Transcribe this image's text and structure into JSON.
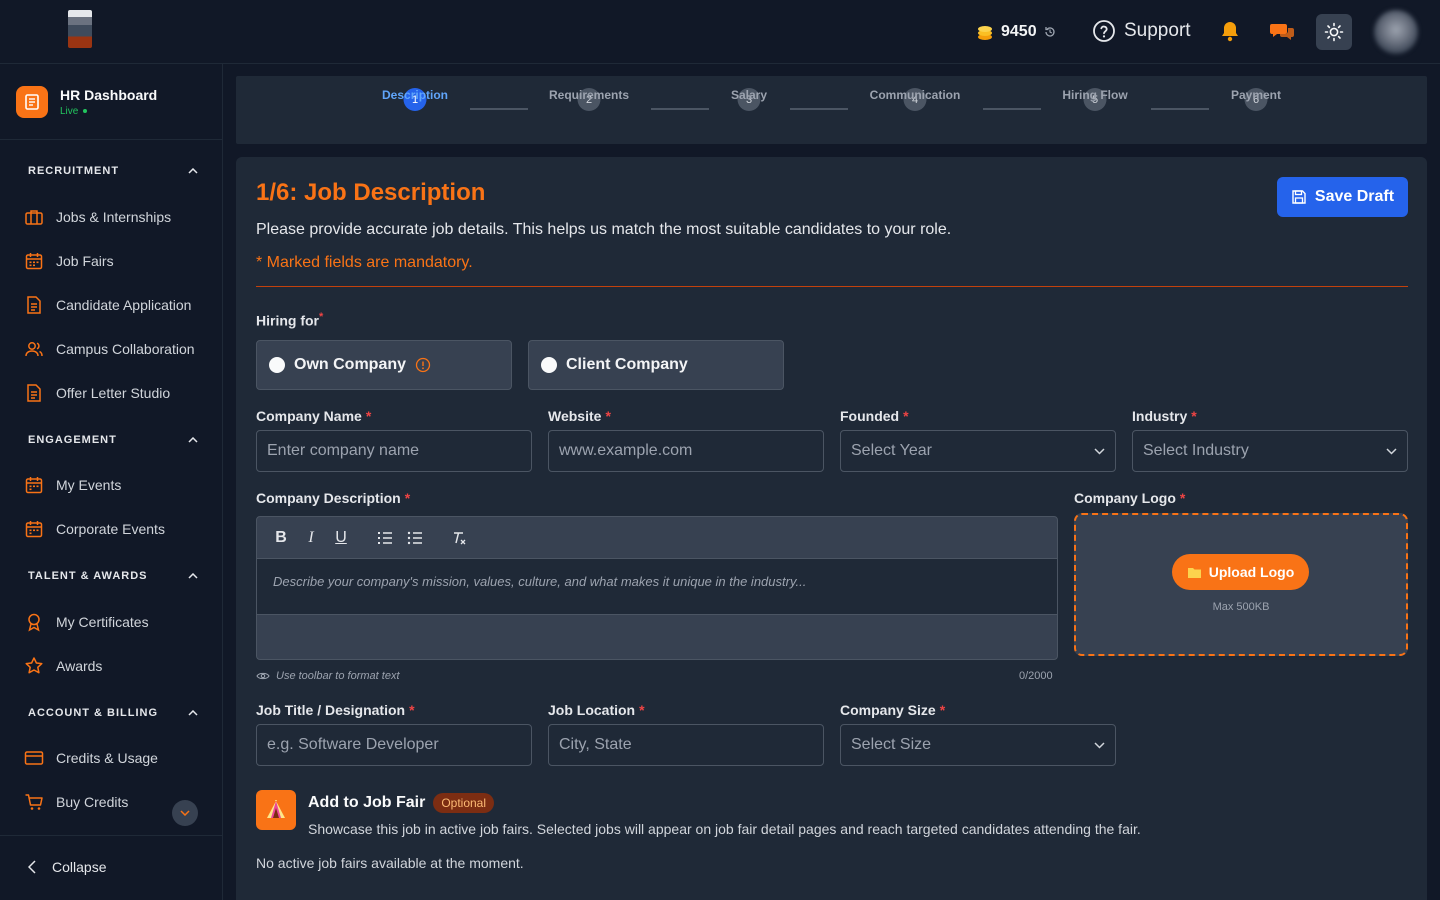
{
  "header": {
    "credits": "9450",
    "support_label": "Support"
  },
  "sidebar": {
    "brand_title": "HR Dashboard",
    "brand_status": "Live",
    "sections": [
      {
        "title": "RECRUITMENT",
        "items": [
          "Jobs & Internships",
          "Job Fairs",
          "Candidate Application",
          "Campus Collaboration",
          "Offer Letter Studio"
        ]
      },
      {
        "title": "ENGAGEMENT",
        "items": [
          "My Events",
          "Corporate Events"
        ]
      },
      {
        "title": "TALENT & AWARDS",
        "items": [
          "My Certificates",
          "Awards"
        ]
      },
      {
        "title": "ACCOUNT & BILLING",
        "items": [
          "Credits & Usage",
          "Buy Credits"
        ]
      }
    ],
    "collapse_label": "Collapse"
  },
  "stepper": {
    "steps": [
      {
        "num": "1",
        "label": "Description",
        "active": true
      },
      {
        "num": "2",
        "label": "Requirements"
      },
      {
        "num": "3",
        "label": "Salary"
      },
      {
        "num": "4",
        "label": "Communication"
      },
      {
        "num": "5",
        "label": "Hiring Flow"
      },
      {
        "num": "6",
        "label": "Payment"
      }
    ]
  },
  "form": {
    "title": "1/6: Job Description",
    "lead": "Please provide accurate job details. This helps us match the most suitable candidates to your role.",
    "mandatory_note": "* Marked fields are mandatory.",
    "save_draft": "Save Draft",
    "hiring_for_label": "Hiring for",
    "hiring_options": [
      "Own Company",
      "Client Company"
    ],
    "company_name": {
      "label": "Company Name",
      "placeholder": "Enter company name"
    },
    "website": {
      "label": "Website",
      "placeholder": "www.example.com"
    },
    "founded": {
      "label": "Founded",
      "placeholder": "Select Year"
    },
    "industry": {
      "label": "Industry",
      "placeholder": "Select Industry"
    },
    "description": {
      "label": "Company Description",
      "placeholder": "Describe your company's mission, values, culture, and what makes it unique in the industry...",
      "hint": "Use toolbar to format text",
      "count": "0/2000"
    },
    "logo": {
      "label": "Company Logo",
      "button": "Upload Logo",
      "max": "Max 500KB"
    },
    "job_title": {
      "label": "Job Title / Designation",
      "placeholder": "e.g. Software Developer"
    },
    "job_location": {
      "label": "Job Location",
      "placeholder": "City, State"
    },
    "company_size": {
      "label": "Company Size",
      "placeholder": "Select Size"
    },
    "job_fair": {
      "title": "Add to Job Fair",
      "badge": "Optional",
      "description": "Showcase this job in active job fairs. Selected jobs will appear on job fair detail pages and reach targeted candidates attending the fair.",
      "empty": "No active job fairs available at the moment."
    }
  },
  "colors": {
    "accent": "#f97316",
    "primary": "#2563eb",
    "background": "#111827",
    "surface": "#1f2937"
  }
}
